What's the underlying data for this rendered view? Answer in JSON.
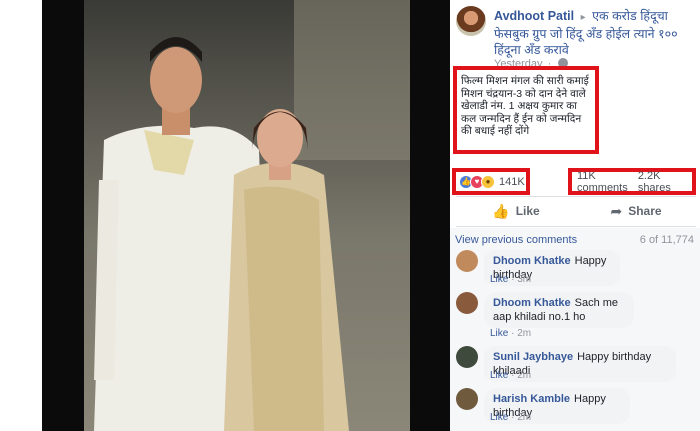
{
  "post": {
    "author": "Avdhoot Patil",
    "arrow": "▸",
    "group": "एक करोड हिंदूचा फेसबुक ग्रुप जो हिंदू ॲंड होईल त्याने १०० हिंदूना ॲंड करावे",
    "time": "Yesterday",
    "dot": "·",
    "text": "फिल्म मिशन मंगल की सारी कमाई मिशन चंद्रयान-3 को दान देने वाले खेलाडी नंम. 1 अक्षय कुमार का कल जन्मदिन हैं ईन को जन्मदिन की बधाई नहीं दोंगे",
    "reactions": {
      "count": "141K",
      "icons": [
        "like-icon",
        "love-icon",
        "wow-icon"
      ]
    },
    "comments_count": "11K comments",
    "shares_count": "2.2K shares",
    "actions": {
      "like": "Like",
      "share": "Share"
    }
  },
  "comments_section": {
    "view_previous": "View previous comments",
    "position": "6 of 11,774",
    "items": [
      {
        "name": "Dhoom Khatke",
        "text": "Happy birthday",
        "like": "Like",
        "time": "3m"
      },
      {
        "name": "Dhoom Khatke",
        "text": "Sach me aap khiladi no.1 ho",
        "like": "Like",
        "time": "2m"
      },
      {
        "name": "Sunil Jaybhaye",
        "text": "Happy birthday khilaadi",
        "like": "Like",
        "time": "2m"
      },
      {
        "name": "Harish Kamble",
        "text": "Happy birthday",
        "like": "Like",
        "time": "2m"
      }
    ]
  },
  "colors": {
    "highlight_border": "#e0121a",
    "link": "#365899",
    "meta": "#90949c"
  }
}
